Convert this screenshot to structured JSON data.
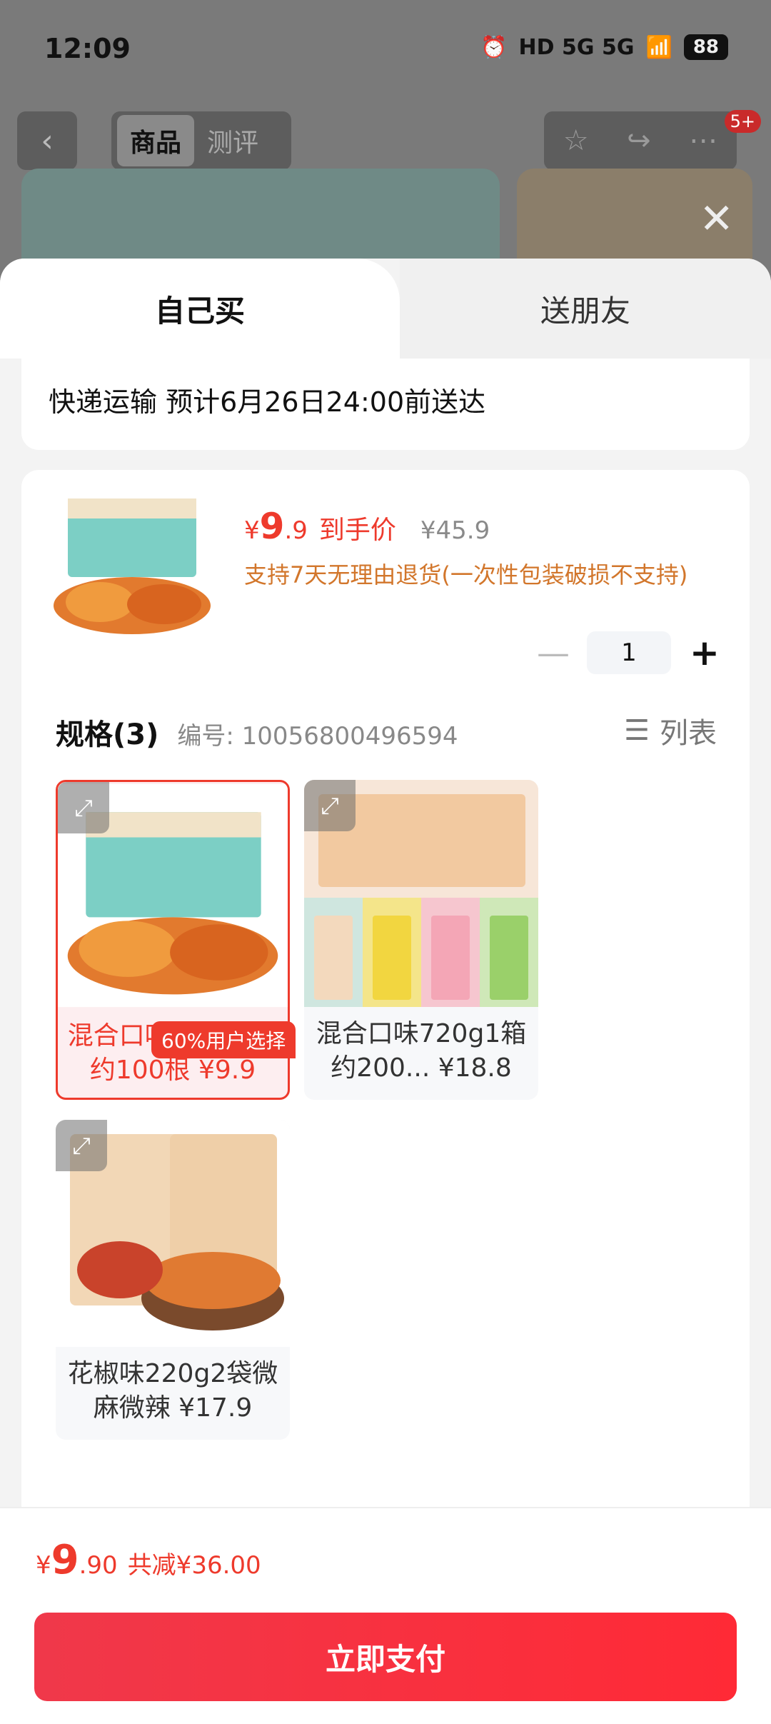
{
  "status_bar": {
    "time": "12:09",
    "network": "HD 5G 5G",
    "battery": "88"
  },
  "nav": {
    "tab_goods": "商品",
    "tab_reviews": "测评",
    "cart_badge": "5+"
  },
  "sheet": {
    "tab_self": "自己买",
    "tab_gift": "送朋友",
    "shipping": "快递运输 预计6月26日24:00前送达"
  },
  "product": {
    "currency": "¥",
    "price_int": "9",
    "price_dec": ".9",
    "price_label": "到手价",
    "original_price": "¥45.9",
    "return_policy": "支持7天无理由退货(一次性包装破损不支持)",
    "quantity": "1"
  },
  "specs": {
    "title": "规格(3)",
    "number": "编号: 10056800496594",
    "list_label": "列表",
    "popular_tag": "60%用户选择",
    "options": [
      {
        "label": "混合口味360g1箱约100根 ¥9.9"
      },
      {
        "label": "混合口味720g1箱约200... ¥18.8"
      },
      {
        "label": "花椒味220g2袋微麻微辣 ¥17.9"
      }
    ]
  },
  "footer": {
    "currency": "¥",
    "total_int": "9",
    "total_dec": ".90",
    "discount": "共减¥36.00",
    "pay_button": "立即支付"
  }
}
